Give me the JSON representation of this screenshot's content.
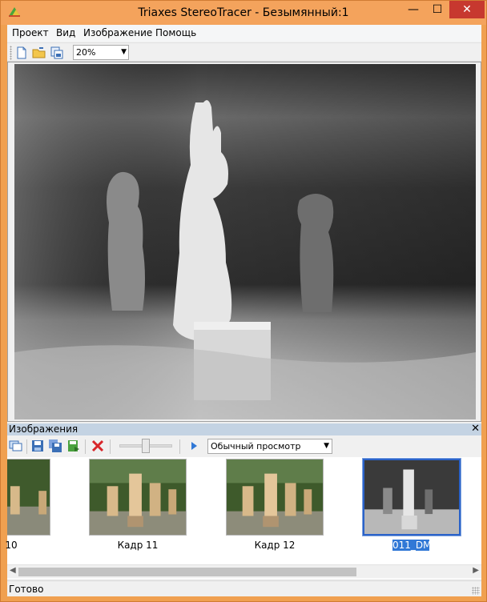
{
  "window": {
    "title": "Triaxes StereoTracer - Безымянный:1",
    "minimize_glyph": "—",
    "maximize_glyph": "☐",
    "close_glyph": "✕"
  },
  "menu": {
    "items": [
      {
        "label": "Проект"
      },
      {
        "label": "Вид"
      },
      {
        "label": "Изображение"
      },
      {
        "label": "Помощь"
      }
    ]
  },
  "toolbar": {
    "icons": [
      "new-file-icon",
      "open-folder-icon",
      "save-copy-icon"
    ],
    "zoom_value": "20%"
  },
  "panel": {
    "title": "Изображения",
    "close_glyph": "✕",
    "icons": [
      "copy-frames-icon",
      "save-icon",
      "save-all-icon",
      "export-icon",
      "delete-icon",
      "play-icon"
    ],
    "slider_value": 0.5,
    "view_mode": "Обычный просмотр"
  },
  "thumbnails": [
    {
      "label": "10",
      "kind": "photo",
      "selected": false
    },
    {
      "label": "Кадр 11",
      "kind": "photo",
      "selected": false
    },
    {
      "label": "Кадр 12",
      "kind": "photo",
      "selected": false
    },
    {
      "label": "011_DM",
      "kind": "depth",
      "selected": true
    }
  ],
  "status": {
    "text": "Готово"
  },
  "colors": {
    "titlebar": "#f4a35c",
    "selection": "#3178d6",
    "panel_header": "#c4d3e3"
  }
}
